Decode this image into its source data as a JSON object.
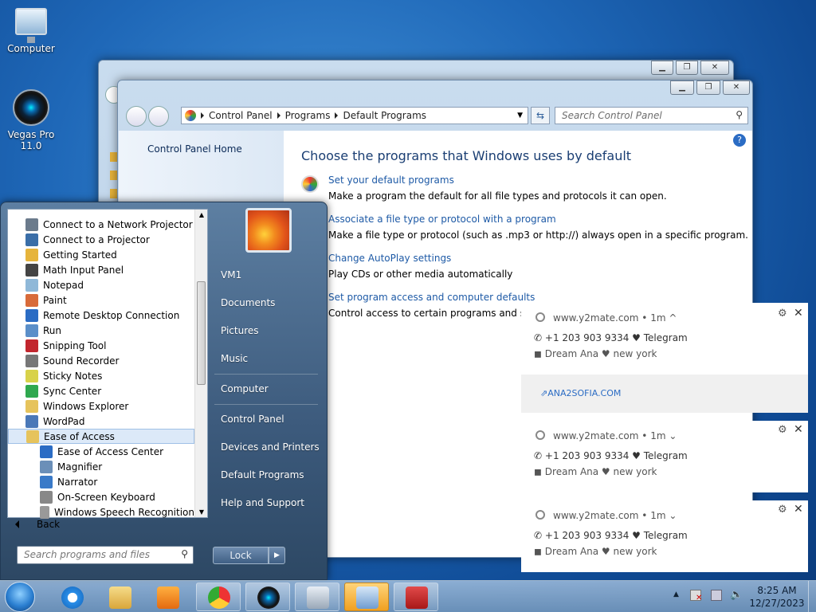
{
  "desktop": {
    "icons": [
      {
        "label": "Computer"
      },
      {
        "label_line1": "Vegas Pro",
        "label_line2": "11.0"
      }
    ]
  },
  "control_panel": {
    "breadcrumb": [
      "Control Panel",
      "Programs",
      "Default Programs"
    ],
    "search_placeholder": "Search Control Panel",
    "sidebar_home": "Control Panel Home",
    "heading": "Choose the programs that Windows uses by default",
    "items": [
      {
        "link": "Set your default programs",
        "desc": "Make a program the default for all file types and protocols it can open."
      },
      {
        "link": "Associate a file type or protocol with a program",
        "desc": "Make a file type or protocol (such as .mp3 or http://) always open in a specific program."
      },
      {
        "link": "Change AutoPlay settings",
        "desc": "Play CDs or other media automatically"
      },
      {
        "link": "Set program access and computer defaults",
        "desc": "Control access to certain programs and set de"
      }
    ]
  },
  "start_menu": {
    "programs": [
      {
        "label": "Connect to a Network Projector",
        "color": "#6b7b8c"
      },
      {
        "label": "Connect to a Projector",
        "color": "#3a6ea8"
      },
      {
        "label": "Getting Started",
        "color": "#e6b43c"
      },
      {
        "label": "Math Input Panel",
        "color": "#444"
      },
      {
        "label": "Notepad",
        "color": "#8fb8d8"
      },
      {
        "label": "Paint",
        "color": "#d86b3a"
      },
      {
        "label": "Remote Desktop Connection",
        "color": "#2b6cc4"
      },
      {
        "label": "Run",
        "color": "#5b8fc9"
      },
      {
        "label": "Snipping Tool",
        "color": "#c2262e"
      },
      {
        "label": "Sound Recorder",
        "color": "#777"
      },
      {
        "label": "Sticky Notes",
        "color": "#d8d24a"
      },
      {
        "label": "Sync Center",
        "color": "#2fa84f"
      },
      {
        "label": "Windows Explorer",
        "color": "#e6c35c"
      },
      {
        "label": "WordPad",
        "color": "#4a78b8"
      },
      {
        "label": "Ease of Access",
        "color": "#e6c35c"
      },
      {
        "label": "Ease of Access Center",
        "color": "#2b6cc4"
      },
      {
        "label": "Magnifier",
        "color": "#6b8fb8"
      },
      {
        "label": "Narrator",
        "color": "#3a7ac8"
      },
      {
        "label": "On-Screen Keyboard",
        "color": "#888"
      },
      {
        "label": "Windows Speech Recognition",
        "color": "#999"
      }
    ],
    "back": "Back",
    "search_placeholder": "Search programs and files",
    "right_items": [
      "VM1",
      "Documents",
      "Pictures",
      "Music",
      "Computer",
      "Control Panel",
      "Devices and Printers",
      "Default Programs",
      "Help and Support"
    ],
    "lock": "Lock"
  },
  "notifications": [
    {
      "source": "www.y2mate.com",
      "time": "• 1m",
      "line1": "+1 203 903 9334 ♥ Telegram",
      "line2": "Dream Ana ♥ new york",
      "link": "ANA2SOFIA.COM"
    },
    {
      "source": "www.y2mate.com",
      "time": "• 1m",
      "line1": "+1 203 903 9334 ♥ Telegram",
      "line2": "Dream Ana ♥ new york"
    },
    {
      "source": "www.y2mate.com",
      "time": "• 1m",
      "line1": "+1 203 903 9334 ♥ Telegram",
      "line2": "Dream Ana ♥ new york"
    }
  ],
  "taskbar": {
    "time": "8:25 AM",
    "date": "12/27/2023"
  }
}
